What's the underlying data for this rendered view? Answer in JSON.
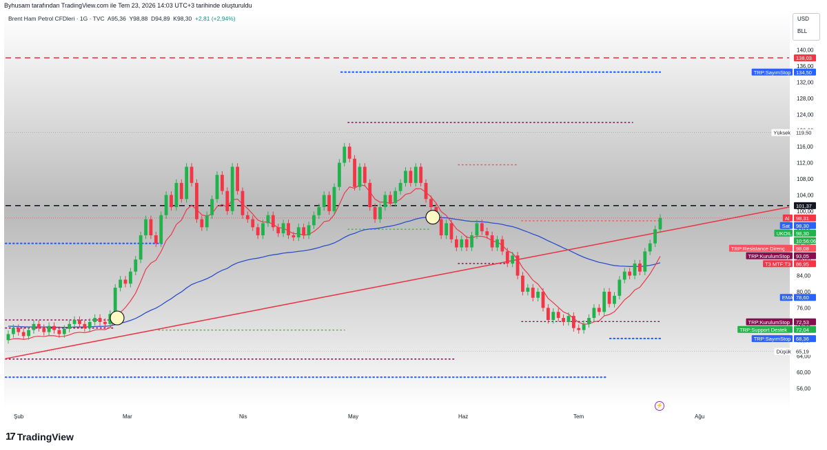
{
  "header": {
    "credit": "Byhusam tarafından TradingView.com ile Tem 23, 2026 14:03 UTC+3 tarihinde oluşturuldu"
  },
  "symbol": {
    "name": "Brent Ham Petrol CFDleri · 1G · TVC",
    "open_label": "A",
    "open": "95,36",
    "high_label": "Y",
    "high": "98,88",
    "low_label": "D",
    "low": "94,89",
    "close_label": "K",
    "close": "98,30",
    "change": "+2,81 (+2,94%)"
  },
  "units": [
    "USD",
    "BLL"
  ],
  "colors": {
    "up": "#22b24c",
    "down": "#f23645",
    "ema": "#2c4fc9",
    "trend": "#e8394a",
    "signal_red": "#f7525f",
    "sayim": "#2962ff",
    "kurulum": "#880e4f",
    "support": "#4caf50"
  },
  "chart_data": {
    "type": "candlestick",
    "y_axis": {
      "min": 52,
      "max": 143,
      "ticks": [
        "56,00",
        "60,00",
        "64,00",
        "68,00",
        "72,00",
        "76,00",
        "80,00",
        "84,00",
        "88,00",
        "92,00",
        "96,00",
        "100,00",
        "104,00",
        "108,00",
        "112,00",
        "116,00",
        "120,00",
        "124,00",
        "128,00",
        "132,00",
        "136,00",
        "140,00"
      ]
    },
    "x_axis": [
      "Şub",
      "Mar",
      "Nis",
      "May",
      "Haz",
      "Tem",
      "Ağu"
    ],
    "price_labels": [
      {
        "name": "",
        "text": "138,03",
        "kind": "red-dashed"
      },
      {
        "name": "TRP:SayımStop",
        "text": "134,50",
        "kind": "blue"
      },
      {
        "name": "Yüksek",
        "text": "119,50",
        "kind": "plain"
      },
      {
        "name": "",
        "text": "101,37",
        "kind": "black"
      },
      {
        "name": "Al",
        "text": "98,31",
        "kind": "red"
      },
      {
        "name": "Sat",
        "text": "98,30",
        "kind": "blue"
      },
      {
        "name": "UKOIL",
        "text": "98,30",
        "kind": "green"
      },
      {
        "name": "",
        "text": "10:56:06",
        "kind": "green"
      },
      {
        "name": "TRP:Resistance Direnç",
        "text": "98,08",
        "kind": "salmon"
      },
      {
        "name": "TRP:KurulumStop",
        "text": "93,05",
        "kind": "maroon"
      },
      {
        "name": "T3 MTF:T3",
        "text": "86,95",
        "kind": "red"
      },
      {
        "name": "EMA",
        "text": "78,60",
        "kind": "blue"
      },
      {
        "name": "TRP:KurulumStop",
        "text": "72,53",
        "kind": "maroon"
      },
      {
        "name": "TRP:Support Destek",
        "text": "72,04",
        "kind": "green"
      },
      {
        "name": "TRP:SayımStop",
        "text": "68,36",
        "kind": "blue"
      },
      {
        "name": "Düşük",
        "text": "65,19",
        "kind": "plain"
      }
    ],
    "candles": [
      {
        "o": 68.0,
        "c": 69.5
      },
      {
        "o": 69.5,
        "c": 71.0
      },
      {
        "o": 71.0,
        "c": 70.0
      },
      {
        "o": 70.0,
        "c": 69.0
      },
      {
        "o": 69.0,
        "c": 70.5
      },
      {
        "o": 70.5,
        "c": 72.0
      },
      {
        "o": 72.0,
        "c": 71.0
      },
      {
        "o": 71.0,
        "c": 70.0
      },
      {
        "o": 70.0,
        "c": 71.5
      },
      {
        "o": 71.5,
        "c": 70.5
      },
      {
        "o": 70.5,
        "c": 69.5
      },
      {
        "o": 69.5,
        "c": 70.8
      },
      {
        "o": 70.8,
        "c": 72.0
      },
      {
        "o": 72.0,
        "c": 73.0
      },
      {
        "o": 73.0,
        "c": 72.0
      },
      {
        "o": 72.0,
        "c": 71.0
      },
      {
        "o": 71.0,
        "c": 72.5
      },
      {
        "o": 72.5,
        "c": 73.5
      },
      {
        "o": 73.5,
        "c": 72.5
      },
      {
        "o": 72.5,
        "c": 72.0
      },
      {
        "o": 72.0,
        "c": 74.5
      },
      {
        "o": 74.5,
        "c": 81.0
      },
      {
        "o": 81.0,
        "c": 83.0
      },
      {
        "o": 83.0,
        "c": 82.0
      },
      {
        "o": 82.0,
        "c": 85.0
      },
      {
        "o": 85.0,
        "c": 88.0
      },
      {
        "o": 88.0,
        "c": 94.0
      },
      {
        "o": 94.0,
        "c": 98.0
      },
      {
        "o": 98.0,
        "c": 94.0
      },
      {
        "o": 94.0,
        "c": 92.0
      },
      {
        "o": 92.0,
        "c": 99.0
      },
      {
        "o": 99.0,
        "c": 104.0
      },
      {
        "o": 104.0,
        "c": 101.0
      },
      {
        "o": 101.0,
        "c": 107.0
      },
      {
        "o": 107.0,
        "c": 103.0
      },
      {
        "o": 103.0,
        "c": 111.0
      },
      {
        "o": 111.0,
        "c": 107.0
      },
      {
        "o": 107.0,
        "c": 98.0
      },
      {
        "o": 98.0,
        "c": 96.0
      },
      {
        "o": 96.0,
        "c": 99.0
      },
      {
        "o": 99.0,
        "c": 103.0
      },
      {
        "o": 103.0,
        "c": 109.0
      },
      {
        "o": 109.0,
        "c": 105.0
      },
      {
        "o": 105.0,
        "c": 100.0
      },
      {
        "o": 100.0,
        "c": 111.0
      },
      {
        "o": 111.0,
        "c": 105.0
      },
      {
        "o": 105.0,
        "c": 99.0
      },
      {
        "o": 99.0,
        "c": 98.0
      },
      {
        "o": 98.0,
        "c": 96.0
      },
      {
        "o": 96.0,
        "c": 94.0
      },
      {
        "o": 94.0,
        "c": 97.0
      },
      {
        "o": 97.0,
        "c": 99.0
      },
      {
        "o": 99.0,
        "c": 96.0
      },
      {
        "o": 96.0,
        "c": 94.5
      },
      {
        "o": 94.5,
        "c": 97.0
      },
      {
        "o": 97.0,
        "c": 94.0
      },
      {
        "o": 94.0,
        "c": 93.5
      },
      {
        "o": 93.5,
        "c": 96.0
      },
      {
        "o": 96.0,
        "c": 94.0
      },
      {
        "o": 94.0,
        "c": 96.5
      },
      {
        "o": 96.5,
        "c": 99.0
      },
      {
        "o": 99.0,
        "c": 101.0
      },
      {
        "o": 101.0,
        "c": 104.0
      },
      {
        "o": 104.0,
        "c": 100.0
      },
      {
        "o": 100.0,
        "c": 106.0
      },
      {
        "o": 106.0,
        "c": 112.0
      },
      {
        "o": 112.0,
        "c": 116.0
      },
      {
        "o": 116.0,
        "c": 113.0
      },
      {
        "o": 113.0,
        "c": 106.0
      },
      {
        "o": 106.0,
        "c": 111.0
      },
      {
        "o": 111.0,
        "c": 107.0
      },
      {
        "o": 107.0,
        "c": 101.0
      },
      {
        "o": 101.0,
        "c": 98.0
      },
      {
        "o": 98.0,
        "c": 101.0
      },
      {
        "o": 101.0,
        "c": 104.0
      },
      {
        "o": 104.0,
        "c": 102.0
      },
      {
        "o": 102.0,
        "c": 105.0
      },
      {
        "o": 105.0,
        "c": 107.0
      },
      {
        "o": 107.0,
        "c": 110.0
      },
      {
        "o": 110.0,
        "c": 107.0
      },
      {
        "o": 107.0,
        "c": 111.0
      },
      {
        "o": 111.0,
        "c": 107.0
      },
      {
        "o": 107.0,
        "c": 103.0
      },
      {
        "o": 103.0,
        "c": 101.0
      },
      {
        "o": 101.0,
        "c": 98.0
      },
      {
        "o": 98.0,
        "c": 94.0
      },
      {
        "o": 94.0,
        "c": 97.0
      },
      {
        "o": 97.0,
        "c": 93.0
      },
      {
        "o": 93.0,
        "c": 91.0
      },
      {
        "o": 91.0,
        "c": 93.0
      },
      {
        "o": 93.0,
        "c": 91.0
      },
      {
        "o": 91.0,
        "c": 94.0
      },
      {
        "o": 94.0,
        "c": 97.0
      },
      {
        "o": 97.0,
        "c": 95.0
      },
      {
        "o": 95.0,
        "c": 94.0
      },
      {
        "o": 94.0,
        "c": 91.0
      },
      {
        "o": 91.0,
        "c": 93.0
      },
      {
        "o": 93.0,
        "c": 90.0
      },
      {
        "o": 90.0,
        "c": 87.0
      },
      {
        "o": 87.0,
        "c": 89.0
      },
      {
        "o": 89.0,
        "c": 84.0
      },
      {
        "o": 84.0,
        "c": 80.0
      },
      {
        "o": 80.0,
        "c": 81.0
      },
      {
        "o": 81.0,
        "c": 78.5
      },
      {
        "o": 78.5,
        "c": 80.0
      },
      {
        "o": 80.0,
        "c": 76.0
      },
      {
        "o": 76.0,
        "c": 73.0
      },
      {
        "o": 73.0,
        "c": 75.0
      },
      {
        "o": 75.0,
        "c": 73.5
      },
      {
        "o": 73.5,
        "c": 72.5
      },
      {
        "o": 72.5,
        "c": 74.0
      },
      {
        "o": 74.0,
        "c": 71.0
      },
      {
        "o": 71.0,
        "c": 70.5
      },
      {
        "o": 70.5,
        "c": 72.0
      },
      {
        "o": 72.0,
        "c": 73.5
      },
      {
        "o": 73.5,
        "c": 76.0
      },
      {
        "o": 76.0,
        "c": 75.0
      },
      {
        "o": 75.0,
        "c": 80.0
      },
      {
        "o": 80.0,
        "c": 77.0
      },
      {
        "o": 77.0,
        "c": 79.0
      },
      {
        "o": 79.0,
        "c": 83.0
      },
      {
        "o": 83.0,
        "c": 85.0
      },
      {
        "o": 85.0,
        "c": 84.0
      },
      {
        "o": 84.0,
        "c": 87.0
      },
      {
        "o": 87.0,
        "c": 85.0
      },
      {
        "o": 85.0,
        "c": 90.0
      },
      {
        "o": 90.0,
        "c": 92.0
      },
      {
        "o": 92.0,
        "c": 95.5
      },
      {
        "o": 95.5,
        "c": 98.3
      }
    ]
  },
  "footer": {
    "brand": "TradingView"
  }
}
